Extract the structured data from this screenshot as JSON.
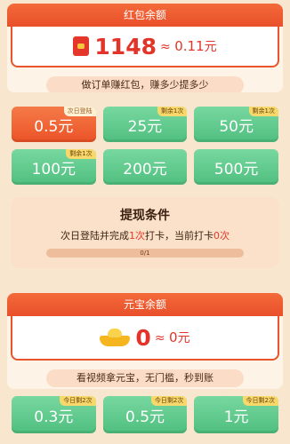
{
  "redpacket_section": {
    "header": "红包余额",
    "amount": "1148",
    "approx_symbol": "≈",
    "approx_value": "0.11",
    "approx_unit": "元",
    "promo_text": "做订单赚红包，赚多少提多少"
  },
  "redpacket_options": [
    {
      "amount": "0.5元",
      "tag": "次日登陆",
      "selected": true
    },
    {
      "amount": "25元",
      "tag": "剩余1次",
      "selected": false
    },
    {
      "amount": "50元",
      "tag": "剩余1次",
      "selected": false
    },
    {
      "amount": "100元",
      "tag": "剩余1次",
      "selected": false
    },
    {
      "amount": "200元",
      "tag": "",
      "selected": false
    },
    {
      "amount": "500元",
      "tag": "",
      "selected": false
    }
  ],
  "withdraw_condition": {
    "title": "提现条件",
    "text_prefix": "次日登陆并完成",
    "text_highlight_1": "1次",
    "text_middle": "打卡，当前打卡",
    "text_highlight_2": "0次",
    "progress_label": "0/1",
    "progress_fraction": 0
  },
  "ingot_section": {
    "header": "元宝余额",
    "amount": "0",
    "approx_symbol": "≈",
    "approx_value": "0",
    "approx_unit": "元",
    "promo_text": "看视频拿元宝，无门槛，秒到账"
  },
  "ingot_options": [
    {
      "amount": "0.3元",
      "tag": "今日剩2次"
    },
    {
      "amount": "0.5元",
      "tag": "今日剩2次"
    },
    {
      "amount": "1元",
      "tag": "今日剩2次"
    }
  ],
  "colors": {
    "primary_red": "#e8502a",
    "green_button": "#4fbf7f",
    "background": "#f8e6cf"
  }
}
